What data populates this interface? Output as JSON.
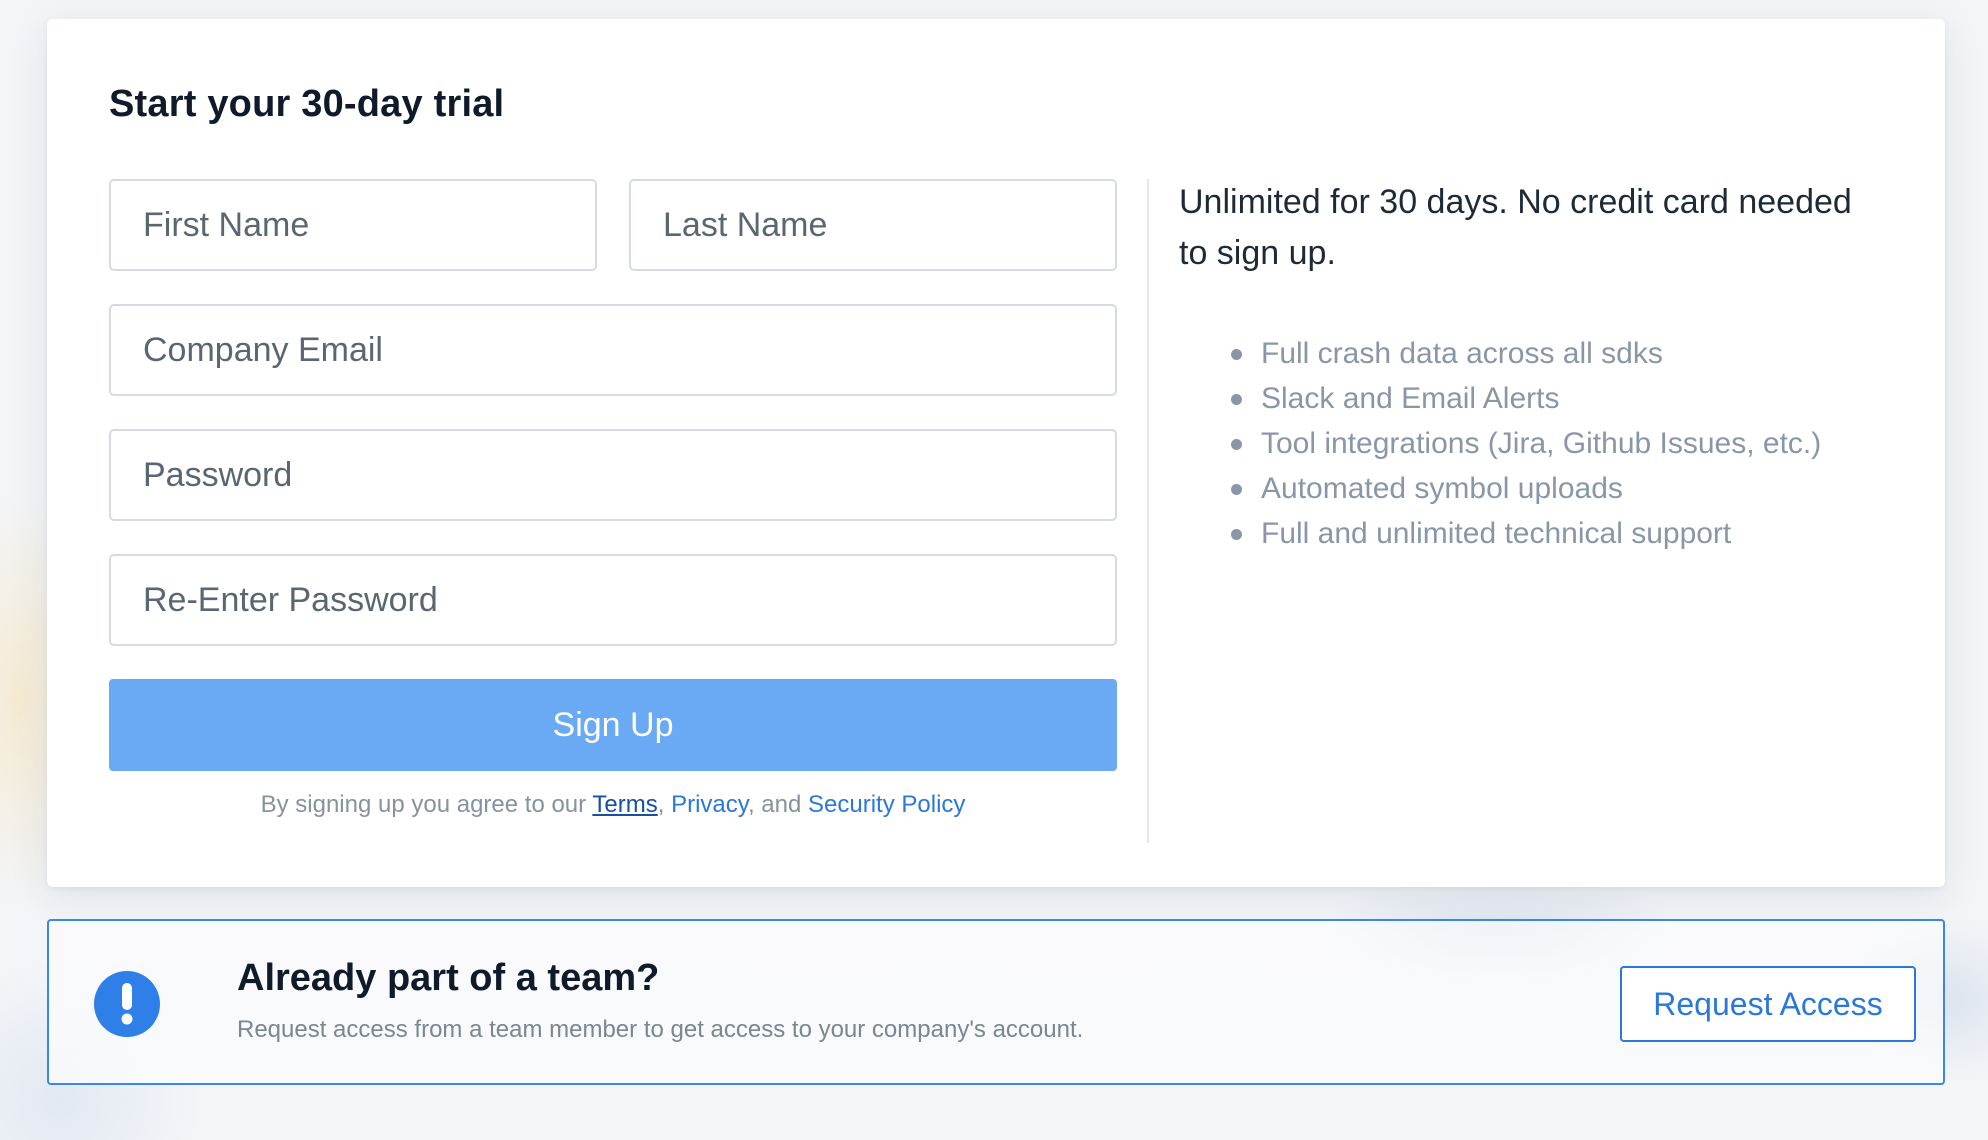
{
  "form": {
    "title": "Start your 30-day trial",
    "first_name_placeholder": "First Name",
    "last_name_placeholder": "Last Name",
    "email_placeholder": "Company Email",
    "password_placeholder": "Password",
    "reenter_password_placeholder": "Re-Enter Password",
    "signup_label": "Sign Up",
    "agree": {
      "prefix": "By signing up you agree to our ",
      "terms": "Terms",
      "sep1": ", ",
      "privacy": "Privacy",
      "sep2": ", and ",
      "security": "Security Policy"
    }
  },
  "info": {
    "headline": "Unlimited for 30 days. No credit card needed to sign up.",
    "features": [
      "Full crash data across all sdks",
      "Slack and Email Alerts",
      "Tool integrations (Jira, Github Issues, etc.)",
      "Automated symbol uploads",
      "Full and unlimited technical support"
    ]
  },
  "team": {
    "icon": "exclamation-icon",
    "title": "Already part of a team?",
    "subtitle": "Request access from a team member to get access to your company's account.",
    "button_label": "Request Access"
  },
  "colors": {
    "primary": "#2b78d8",
    "signup_button": "#6aaaf5",
    "heading": "#0f1a2a",
    "muted": "#8a96a8"
  }
}
